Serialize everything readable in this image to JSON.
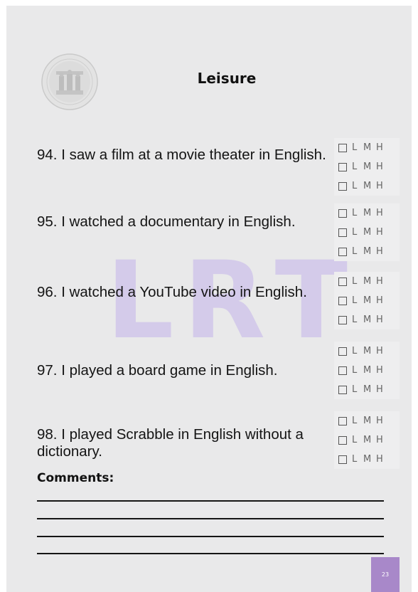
{
  "title": "Leisure",
  "watermark": [
    "L",
    "R",
    "T"
  ],
  "level_labels": [
    "L",
    "M",
    "H"
  ],
  "questions": [
    {
      "text": "94. I saw a film at a movie theater in English."
    },
    {
      "text": "95. I watched a documentary in English."
    },
    {
      "text": "96. I watched a YouTube video in English."
    },
    {
      "text": "97. I played a board game in English."
    },
    {
      "text": "98. I played Scrabble in English without a dictionary."
    }
  ],
  "comments_label": "Comments:",
  "page_number": "23",
  "colors": {
    "page_background": "#e9e9ea",
    "watermark": "#b096ec",
    "badge": "#a888c9",
    "text": "#141414"
  }
}
